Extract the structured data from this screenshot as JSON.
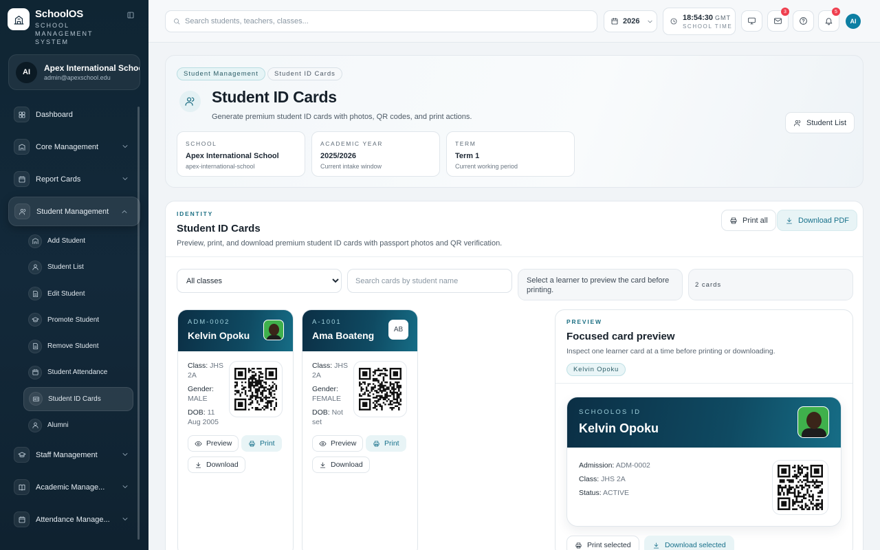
{
  "brand": {
    "name": "SchoolOS",
    "tagline": "SCHOOL MANAGEMENT SYSTEM"
  },
  "school": {
    "initials": "AI",
    "name": "Apex International School",
    "email": "admin@apexschool.edu"
  },
  "nav": {
    "dashboard": "Dashboard",
    "core": "Core Management",
    "report": "Report Cards",
    "student": "Student Management",
    "sub": [
      "Add Student",
      "Student List",
      "Edit Student",
      "Promote Student",
      "Remove Student",
      "Student Attendance",
      "Student ID Cards",
      "Alumni"
    ],
    "staff": "Staff Management",
    "academic": "Academic Manage...",
    "attendance": "Attendance Manage..."
  },
  "topbar": {
    "search_placeholder": "Search students, teachers, classes...",
    "year": "2026",
    "time": "18:54:30",
    "tz": "GMT",
    "time_label": "SCHOOL TIME",
    "mail_badge": "3",
    "notif_badge": "5",
    "user_initials": "AI"
  },
  "hero": {
    "crumbs": [
      "Student Management",
      "Student ID Cards"
    ],
    "title": "Student ID Cards",
    "subtitle": "Generate premium student ID cards with photos, QR codes, and print actions.",
    "list_button": "Student List",
    "stats": [
      {
        "label": "SCHOOL",
        "value": "Apex International School",
        "note": "apex-international-school"
      },
      {
        "label": "ACADEMIC YEAR",
        "value": "2025/2026",
        "note": "Current intake window"
      },
      {
        "label": "TERM",
        "value": "Term 1",
        "note": "Current working period"
      }
    ]
  },
  "panel": {
    "label": "IDENTITY",
    "title": "Student ID Cards",
    "subtitle": "Preview, print, and download premium student ID cards with passport photos and QR verification.",
    "print_all": "Print all",
    "download_pdf": "Download PDF",
    "class_filter": "All classes",
    "search_placeholder": "Search cards by student name",
    "hint": "Select a learner to preview the card before printing.",
    "count": "2 cards"
  },
  "cards": [
    {
      "adm": "ADM-0002",
      "name": "Kelvin Opoku",
      "class_k": "Class:",
      "class_v": "JHS 2A",
      "gender_k": "Gender:",
      "gender_v": "MALE",
      "dob_k": "DOB:",
      "dob_v": "11 Aug 2005"
    },
    {
      "adm": "A-1001",
      "name": "Ama Boateng",
      "initials": "AB",
      "class_k": "Class:",
      "class_v": "JHS 2A",
      "gender_k": "Gender:",
      "gender_v": "FEMALE",
      "dob_k": "DOB:",
      "dob_v": "Not set"
    }
  ],
  "card_actions": {
    "preview": "Preview",
    "print": "Print",
    "download": "Download"
  },
  "preview": {
    "label": "PREVIEW",
    "title": "Focused card preview",
    "subtitle": "Inspect one learner card at a time before printing or downloading.",
    "tag": "Kelvin Opoku",
    "card_label": "SCHOOLOS ID",
    "name": "Kelvin Opoku",
    "adm_k": "Admission:",
    "adm_v": "ADM-0002",
    "class_k": "Class:",
    "class_v": "JHS 2A",
    "status_k": "Status:",
    "status_v": "ACTIVE",
    "print_selected": "Print selected",
    "download_selected": "Download selected"
  },
  "colors": {
    "sidebar": "#13293a",
    "accent": "#16708a",
    "badge": "#ef3f4f",
    "card_header": "#0f4a62"
  }
}
